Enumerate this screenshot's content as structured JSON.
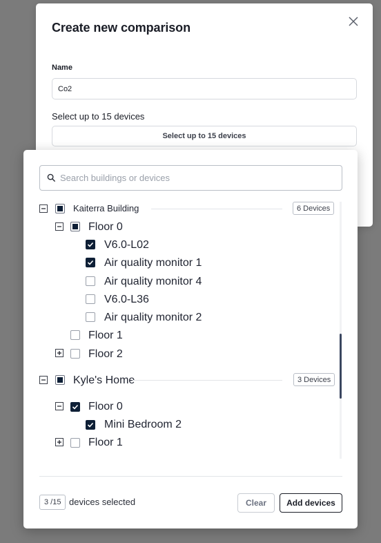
{
  "modal": {
    "title": "Create new comparison",
    "name_label": "Name",
    "name_value": "Co2",
    "devices_label": "Select up to 15 devices",
    "devices_button": "Select up to 15 devices"
  },
  "search": {
    "placeholder": "Search buildings or devices"
  },
  "tree": {
    "buildings": [
      {
        "name": "Kaiterra Building",
        "badge": "6 Devices",
        "expanded": true,
        "state": "partial",
        "floors": [
          {
            "name": "Floor 0",
            "expanded": true,
            "state": "partial",
            "devices": [
              {
                "name": "V6.0-L02",
                "checked": true
              },
              {
                "name": "Air quality monitor 1",
                "checked": true
              },
              {
                "name": "Air quality monitor 4",
                "checked": false
              },
              {
                "name": "V6.0-L36",
                "checked": false
              },
              {
                "name": "Air quality monitor 2",
                "checked": false
              }
            ]
          },
          {
            "name": "Floor 1",
            "expanded": null,
            "state": "unchecked"
          },
          {
            "name": "Floor 2",
            "expanded": false,
            "state": "unchecked"
          }
        ]
      },
      {
        "name": "Kyle's Home",
        "badge": "3 Devices",
        "expanded": true,
        "state": "partial",
        "floors": [
          {
            "name": "Floor 0",
            "expanded": true,
            "state": "checked",
            "devices": [
              {
                "name": "Mini Bedroom 2",
                "checked": true
              }
            ]
          },
          {
            "name": "Floor 1",
            "expanded": false,
            "state": "unchecked"
          }
        ]
      }
    ]
  },
  "footer": {
    "count": "3 /15",
    "count_label": "devices selected",
    "clear_label": "Clear",
    "add_label": "Add devices"
  },
  "colors": {
    "checkbox_checked": "#0e1f36",
    "overlay": "#7b7b7b",
    "scroll_thumb": "#3a4660"
  }
}
